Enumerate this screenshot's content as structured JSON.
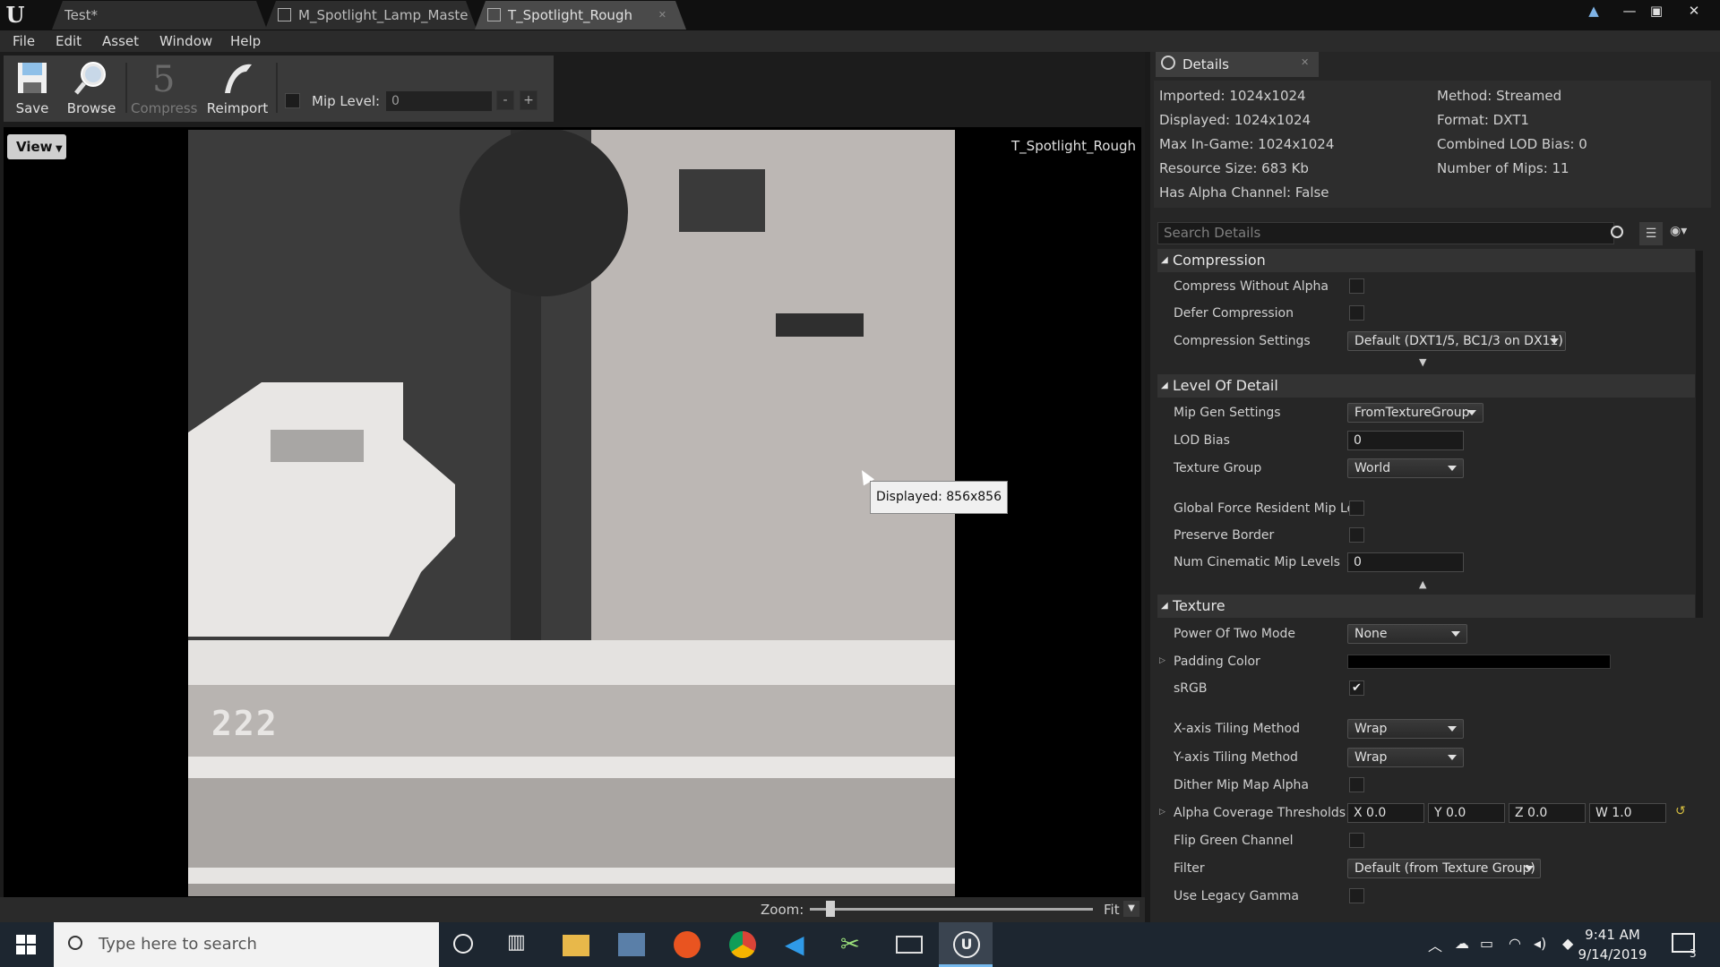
{
  "app": {
    "tabs": [
      "Test*",
      "M_Spotlight_Lamp_Maste",
      "T_Spotlight_Rough"
    ],
    "logo": "U"
  },
  "menu": [
    "File",
    "Edit",
    "Asset",
    "Window",
    "Help"
  ],
  "toolbar": {
    "save": "Save",
    "browse": "Browse",
    "compress": "Compress",
    "reimport": "Reimport",
    "mip_label": "Mip Level:",
    "mip_value": "0",
    "minus": "-",
    "plus": "+"
  },
  "viewport": {
    "view_button": "View",
    "texture_name": "T_Spotlight_Rough",
    "tooltip": "Displayed: 856x856",
    "texture_text": "222"
  },
  "zoom": {
    "label": "Zoom:",
    "fit": "Fit"
  },
  "details": {
    "tab_label": "Details",
    "info_left": [
      "Imported: 1024x1024",
      "Displayed: 1024x1024",
      "Max In-Game: 1024x1024",
      "Resource Size: 683 Kb",
      "Has Alpha Channel: False"
    ],
    "info_right": [
      "Method: Streamed",
      "Format: DXT1",
      "Combined LOD Bias: 0",
      "Number of Mips: 11"
    ],
    "search_placeholder": "Search Details",
    "sections": {
      "compression": "Compression",
      "lod": "Level Of Detail",
      "texture": "Texture"
    },
    "props": {
      "compress_without_alpha": "Compress Without Alpha",
      "defer_compression": "Defer Compression",
      "compression_settings": "Compression Settings",
      "compression_settings_value": "Default (DXT1/5, BC1/3 on DX11)",
      "mip_gen_settings": "Mip Gen Settings",
      "mip_gen_settings_value": "FromTextureGroup",
      "lod_bias": "LOD Bias",
      "lod_bias_value": "0",
      "texture_group": "Texture Group",
      "texture_group_value": "World",
      "global_force_resident": "Global Force Resident Mip Le",
      "preserve_border": "Preserve Border",
      "num_cinematic_mips": "Num Cinematic Mip Levels",
      "num_cinematic_mips_value": "0",
      "power_of_two": "Power Of Two Mode",
      "power_of_two_value": "None",
      "padding_color": "Padding Color",
      "srgb": "sRGB",
      "x_tiling": "X-axis Tiling Method",
      "x_tiling_value": "Wrap",
      "y_tiling": "Y-axis Tiling Method",
      "y_tiling_value": "Wrap",
      "dither_mip_alpha": "Dither Mip Map Alpha",
      "alpha_coverage": "Alpha Coverage Thresholds",
      "alpha_x": "X  0.0",
      "alpha_y": "Y  0.0",
      "alpha_z": "Z  0.0",
      "alpha_w": "W  1.0",
      "flip_green": "Flip Green Channel",
      "filter": "Filter",
      "filter_value": "Default (from Texture Group)",
      "legacy_gamma": "Use Legacy Gamma"
    }
  },
  "taskbar": {
    "search_placeholder": "Type here to search",
    "time": "9:41 AM",
    "date": "9/14/2019",
    "notifications": "3"
  },
  "colors": {
    "padding_color": "#000000",
    "accent": "#0078d7"
  }
}
